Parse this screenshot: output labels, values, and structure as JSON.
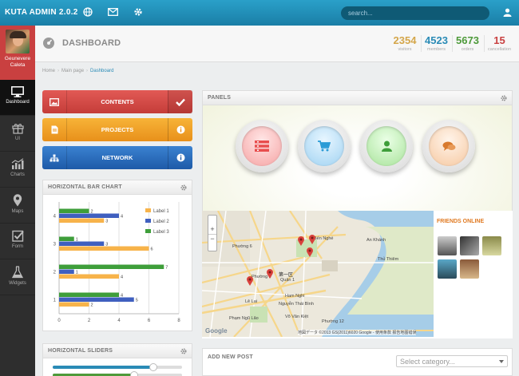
{
  "app": {
    "brand": "KUTA ADMIN 2.0.2"
  },
  "topbar": {
    "search_placeholder": "search...",
    "icons": [
      "globe-icon",
      "mail-icon",
      "gear-icon",
      "user-icon"
    ]
  },
  "user": {
    "name_line1": "Geunevere",
    "name_line2": "Caleta"
  },
  "sidebar": {
    "items": [
      {
        "label": "Dashboard",
        "icon": "monitor-icon",
        "active": true
      },
      {
        "label": "UI",
        "icon": "gift-icon"
      },
      {
        "label": "Charts",
        "icon": "bar-chart-icon"
      },
      {
        "label": "Maps",
        "icon": "map-marker-icon"
      },
      {
        "label": "Form",
        "icon": "checkbox-icon"
      },
      {
        "label": "Widgets",
        "icon": "flask-icon"
      }
    ]
  },
  "header": {
    "title": "DASHBOARD",
    "stats": [
      {
        "value": "2354",
        "label": "visitors",
        "color": "#d4a64a"
      },
      {
        "value": "4523",
        "label": "members",
        "color": "#2a8bb6"
      },
      {
        "value": "5673",
        "label": "orders",
        "color": "#4e9a3a"
      },
      {
        "value": "15",
        "label": "cancellation",
        "color": "#c94040"
      }
    ]
  },
  "breadcrumb": {
    "home": "Home",
    "main": "Main page",
    "current": "Dashboard"
  },
  "buttons": [
    {
      "label": "CONTENTS",
      "color": "#d64542",
      "action_icon": "check-icon"
    },
    {
      "label": "PROJECTS",
      "color": "#f0a020",
      "action_icon": "info-icon"
    },
    {
      "label": "NETWORK",
      "color": "#2a6fbf",
      "action_icon": "info-icon"
    }
  ],
  "panels_widget": {
    "title": "PANELS",
    "circles": [
      {
        "icon": "list-icon",
        "color": "#e84e4e"
      },
      {
        "icon": "cart-icon",
        "color": "#2a9bd6"
      },
      {
        "icon": "user-icon",
        "color": "#3e9e3a"
      },
      {
        "icon": "chat-icon",
        "color": "#d87a2e"
      }
    ]
  },
  "bar_chart_panel": {
    "title": "HORIZONTAL BAR CHART"
  },
  "chart_data": {
    "type": "bar",
    "orientation": "horizontal",
    "categories": [
      "1",
      "2",
      "3",
      "4"
    ],
    "series": [
      {
        "name": "Label 1",
        "color": "#f7b34a",
        "values": [
          2,
          4,
          6,
          3
        ]
      },
      {
        "name": "Label 2",
        "color": "#3f5fbf",
        "values": [
          5,
          1,
          3,
          4
        ]
      },
      {
        "name": "Label 3",
        "color": "#3e9e3a",
        "values": [
          4,
          7,
          1,
          2
        ]
      }
    ],
    "xlim": [
      0,
      8
    ],
    "xticks": [
      "0",
      "2",
      "4",
      "6",
      "8"
    ],
    "legend": "top-right",
    "grid": true
  },
  "sliders_panel": {
    "title": "HORIZONTAL SLIDERS",
    "values": [
      0.78,
      0.63
    ]
  },
  "map": {
    "labels": [
      "Phường 6",
      "Phường 9",
      "Quận 1",
      "Bến Nghé",
      "An Khánh",
      "Thủ Thiêm",
      "Lê Lai",
      "Ham Nghi",
      "Nguyễn Thái Bình",
      "Phạm Ngũ Lão",
      "Phường 12",
      "Võ Văn Kiệt",
      "第一区",
      "Thủ Thiêm"
    ],
    "copyright": "地図データ ©2013 GS(2011)6020 Google - 使用条款 报告地图错误",
    "google_logo": "Google",
    "zoom_in": "+",
    "zoom_out": "−"
  },
  "friends": {
    "title": "FRIENDS ONLINE",
    "count": 6
  },
  "new_post": {
    "title": "ADD NEW POST",
    "category_placeholder": "Select category..."
  }
}
